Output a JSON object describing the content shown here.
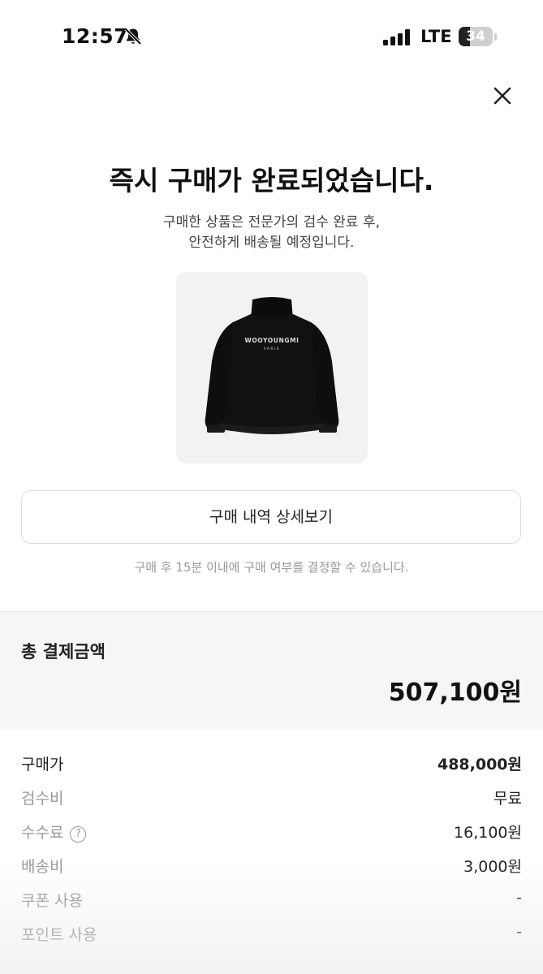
{
  "status_bar": {
    "time": "12:57",
    "network": "LTE",
    "battery": "34",
    "battery_level": 0.34,
    "icons": [
      "bell-slash-icon",
      "signal-icon",
      "battery-icon"
    ]
  },
  "header": {
    "close_icon": "close-icon"
  },
  "main": {
    "title": "즉시 구매가 완료되었습니다.",
    "subtitle_line1": "구매한 상품은 전문가의 검수 완료 후,",
    "subtitle_line2": "안전하게 배송될 예정입니다.",
    "product_print": "WOOYOUNGMI",
    "product_print_sub": "PARIS",
    "detail_button": "구매 내역 상세보기",
    "notice": "구매 후 15분 이내에 구매 여부를 결정할 수 있습니다."
  },
  "summary": {
    "label": "총 결제금액",
    "value": "507,100원"
  },
  "fees": [
    {
      "label": "구매가",
      "value": "488,000원"
    },
    {
      "label": "검수비",
      "value": "무료"
    },
    {
      "label": "수수료",
      "value": "16,100원",
      "help": "?"
    },
    {
      "label": "배송비",
      "value": "3,000원"
    },
    {
      "label": "쿠폰 사용",
      "value": "-"
    },
    {
      "label": "포인트 사용",
      "value": "-"
    }
  ],
  "colors": {
    "background": "#ffffff",
    "summary_bg": "#f6f6f6",
    "muted_text": "#999999",
    "primary_text": "#222222"
  }
}
